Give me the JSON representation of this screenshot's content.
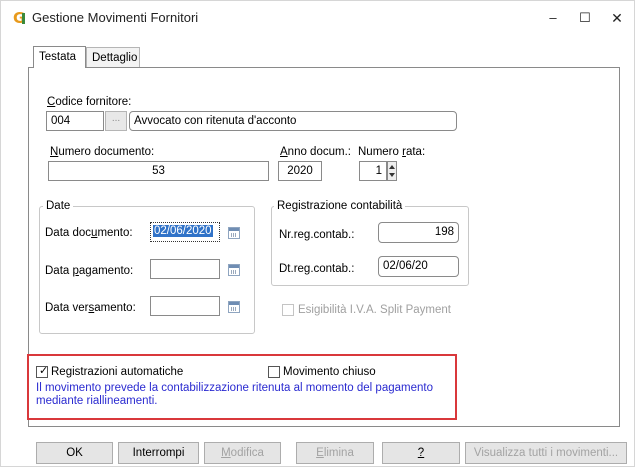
{
  "window": {
    "title": "Gestione Movimenti Fornitori",
    "app_icon_letter": "G",
    "minimize": "–",
    "maximize": "☐",
    "close": "✕"
  },
  "tabs": [
    {
      "label": "Testata",
      "active": true
    },
    {
      "label": "Dettaglio",
      "active": false
    }
  ],
  "fornitore": {
    "label_first": "C",
    "label_rest": "odice fornitore:",
    "code": "004",
    "lookup_label": "...",
    "description": "Avvocato con ritenuta d'acconto"
  },
  "documento": {
    "numero_label_first": "N",
    "numero_label_rest": "umero documento:",
    "numero_value": "53",
    "anno_label_first": "A",
    "anno_label_rest": "nno docum.:",
    "anno_value": "2020",
    "rata_label_pre": "Numero ",
    "rata_label_u": "r",
    "rata_label_post": "ata:",
    "rata_value": "1"
  },
  "date_group": {
    "title": "Date",
    "documento_label_pre": "Data doc",
    "documento_label_u": "u",
    "documento_label_post": "mento:",
    "documento_value": "02/06/2020",
    "pagamento_label_pre": "Data ",
    "pagamento_label_u": "p",
    "pagamento_label_post": "agamento:",
    "pagamento_value": "",
    "versamento_label_pre": "Data ver",
    "versamento_label_u": "s",
    "versamento_label_post": "amento:",
    "versamento_value": ""
  },
  "registrazione_group": {
    "title": "Registrazione contabilità",
    "nr_label": "Nr.reg.contab.:",
    "nr_value": "198",
    "dt_label": "Dt.reg.contab.:",
    "dt_value": "02/06/20",
    "split_payment_label": "Esigibilità I.V.A. Split Payment",
    "split_payment_checked": false
  },
  "options": {
    "automatiche_label": "Registrazioni automatiche",
    "automatiche_checked": true,
    "chiuso_label": "Movimento chiuso",
    "chiuso_checked": false,
    "note_line1": "Il movimento prevede la contabilizzazione ritenuta al momento del pagamento",
    "note_line2": "mediante riallineamenti.",
    "highlight_color": "#d9383b",
    "note_color": "#2a2ad0"
  },
  "buttons": {
    "ok": "OK",
    "interrompi": "Interrompi",
    "modifica_u": "M",
    "modifica_rest": "odifica",
    "elimina_u": "E",
    "elimina_rest": "limina",
    "help": "?",
    "visualizza": "Visualizza tutti i movimenti..."
  },
  "icons": {
    "calendar": "calendar-icon",
    "check": "✓"
  }
}
